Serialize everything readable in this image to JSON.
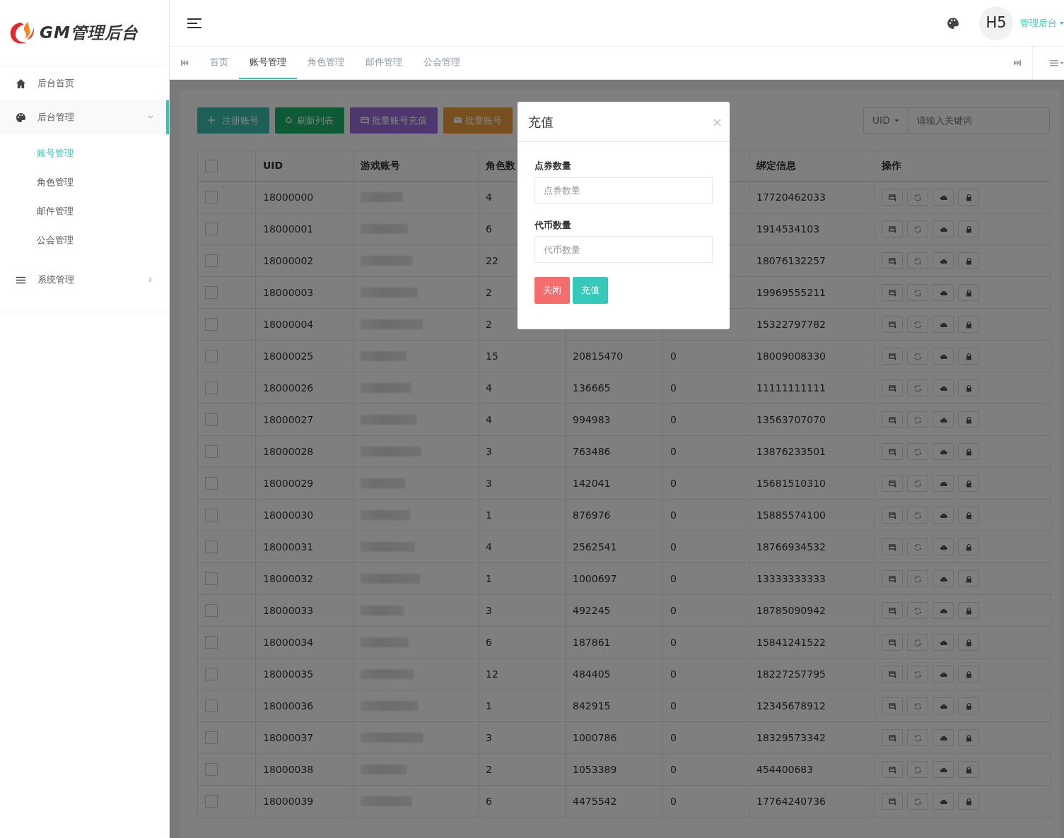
{
  "logo": {
    "text": "GM管理后台"
  },
  "sidebar": {
    "items": [
      {
        "label": "后台首页",
        "kind": "home",
        "selected": false
      },
      {
        "label": "后台管理",
        "kind": "palette",
        "selected": true,
        "expanded": true,
        "children": [
          {
            "label": "账号管理",
            "selected": true
          },
          {
            "label": "角色管理",
            "selected": false
          },
          {
            "label": "邮件管理",
            "selected": false
          },
          {
            "label": "公会管理",
            "selected": false
          }
        ]
      },
      {
        "label": "系统管理",
        "kind": "bars",
        "selected": false,
        "expanded": false
      }
    ]
  },
  "header": {
    "avatar": "H5",
    "user": "管理后台"
  },
  "tabs": [
    {
      "label": "首页",
      "selected": false
    },
    {
      "label": "账号管理",
      "selected": true
    },
    {
      "label": "角色管理",
      "selected": false
    },
    {
      "label": "邮件管理",
      "selected": false
    },
    {
      "label": "公会管理",
      "selected": false
    }
  ],
  "toolbar": {
    "buttons": [
      {
        "label": "注册账号",
        "kind": "add"
      },
      {
        "label": "刷新列表",
        "kind": "refresh"
      },
      {
        "label": "批量账号充值",
        "kind": "card"
      },
      {
        "label": "批量账号",
        "kind": "mail"
      }
    ],
    "search": {
      "field": "UID",
      "placeholder": "请输入关键词"
    }
  },
  "table": {
    "select_all_checked": false,
    "columns": [
      "UID",
      "游戏账号",
      "角色数",
      null,
      null,
      "绑定信息",
      "操作"
    ],
    "rows": [
      {
        "checked": false,
        "uid": "18000000",
        "roles": "4",
        "binding": "17720462033"
      },
      {
        "checked": false,
        "uid": "18000001",
        "roles": "6",
        "binding": "1914534103"
      },
      {
        "checked": false,
        "uid": "18000002",
        "roles": "22",
        "binding": "18076132257"
      },
      {
        "checked": false,
        "uid": "18000003",
        "roles": "2",
        "binding": "19969555211"
      },
      {
        "checked": false,
        "uid": "18000004",
        "roles": "2",
        "binding": "15322797782"
      },
      {
        "checked": false,
        "uid": "18000025",
        "roles": "15",
        "column_5": "20815470",
        "column_6": "0",
        "binding": "18009008330"
      },
      {
        "checked": false,
        "uid": "18000026",
        "roles": "4",
        "column_5": "136665",
        "column_6": "0",
        "binding": "11111111111"
      },
      {
        "checked": false,
        "uid": "18000027",
        "roles": "4",
        "column_5": "994983",
        "column_6": "0",
        "binding": "13563707070"
      },
      {
        "checked": false,
        "uid": "18000028",
        "roles": "3",
        "column_5": "763486",
        "column_6": "0",
        "binding": "13876233501"
      },
      {
        "checked": false,
        "uid": "18000029",
        "roles": "3",
        "column_5": "142041",
        "column_6": "0",
        "binding": "15681510310"
      },
      {
        "checked": false,
        "uid": "18000030",
        "roles": "1",
        "column_5": "876976",
        "column_6": "0",
        "binding": "15885574100"
      },
      {
        "checked": false,
        "uid": "18000031",
        "roles": "4",
        "column_5": "2562541",
        "column_6": "0",
        "binding": "18766934532"
      },
      {
        "checked": false,
        "uid": "18000032",
        "roles": "1",
        "column_5": "1000697",
        "column_6": "0",
        "binding": "13333333333"
      },
      {
        "checked": false,
        "uid": "18000033",
        "roles": "3",
        "column_5": "492245",
        "column_6": "0",
        "binding": "18785090942"
      },
      {
        "checked": false,
        "uid": "18000034",
        "roles": "6",
        "column_5": "187861",
        "column_6": "0",
        "binding": "15841241522"
      },
      {
        "checked": false,
        "uid": "18000035",
        "roles": "12",
        "column_5": "484405",
        "column_6": "0",
        "binding": "18227257795"
      },
      {
        "checked": false,
        "uid": "18000036",
        "roles": "1",
        "column_5": "842915",
        "column_6": "0",
        "binding": "12345678912"
      },
      {
        "checked": false,
        "uid": "18000037",
        "roles": "3",
        "column_5": "1000786",
        "column_6": "0",
        "binding": "18329573342"
      },
      {
        "checked": false,
        "uid": "18000038",
        "roles": "2",
        "column_5": "1053389",
        "column_6": "0",
        "binding": "454400683"
      },
      {
        "checked": false,
        "uid": "18000039",
        "roles": "6",
        "column_5": "4475542",
        "column_6": "0",
        "binding": "17764240736"
      }
    ]
  },
  "modal": {
    "title": "充值",
    "fields": [
      {
        "label": "点券数量",
        "placeholder": "点券数量"
      },
      {
        "label": "代币数量",
        "placeholder": "代币数量"
      }
    ],
    "buttons": [
      {
        "label": "关闭",
        "kind": "close"
      },
      {
        "label": "充值",
        "kind": "submit"
      }
    ]
  }
}
